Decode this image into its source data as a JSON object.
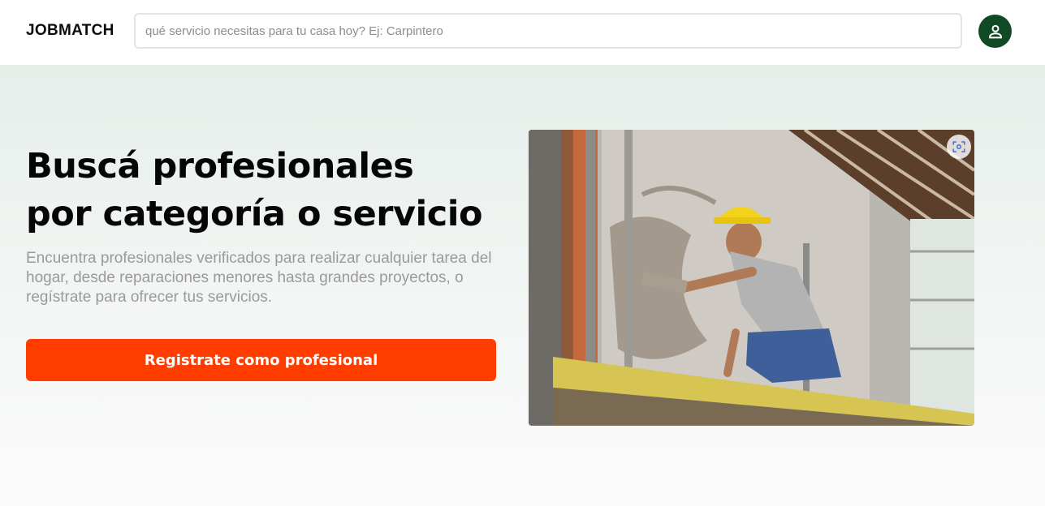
{
  "header": {
    "logo": "JOBMATCH",
    "search": {
      "placeholder": "qué servicio necesitas para tu casa hoy? Ej: Carpintero",
      "value": ""
    },
    "profile_icon": "user-icon"
  },
  "hero": {
    "title_line1": "Buscá profesionales",
    "title_line2": "por categoría o servicio",
    "description": "Encuentra profesionales verificados para realizar cualquier tarea del hogar, desde reparaciones menores hasta grandes proyectos, o regístrate para ofrecer tus servicios.",
    "cta_label": "Registrate como profesional",
    "image_icon": "visual-search-icon"
  },
  "colors": {
    "accent": "#ff3d00",
    "brand_green": "#0f4a24",
    "text_muted": "#9a9a9a"
  }
}
